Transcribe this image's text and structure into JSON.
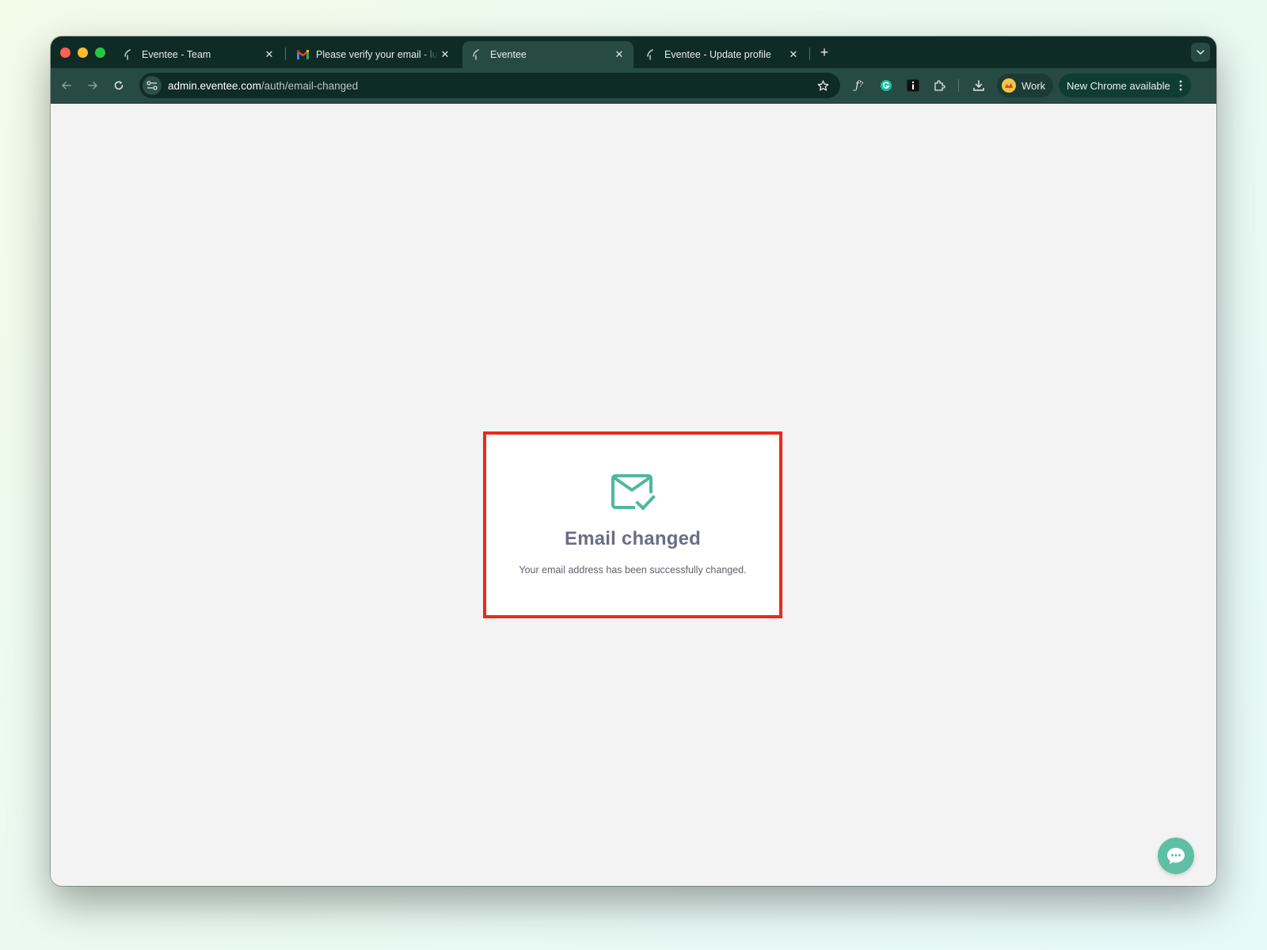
{
  "browser": {
    "tabs": [
      {
        "title": "Eventee - Team",
        "favicon": "eventee-logo-icon",
        "active": false
      },
      {
        "title": "Please verify your email - luc",
        "favicon": "gmail-icon",
        "active": false
      },
      {
        "title": "Eventee",
        "favicon": "eventee-logo-icon",
        "active": true
      },
      {
        "title": "Eventee - Update profile",
        "favicon": "eventee-logo-icon",
        "active": false
      }
    ],
    "close_glyph": "✕",
    "new_tab_glyph": "+",
    "address_bar": {
      "host": "admin.eventee.com",
      "path": "/auth/email-changed"
    },
    "profile_label": "Work",
    "update_label": "New Chrome available",
    "theme": {
      "frame": "#0f2b26",
      "toolbar": "#274a43"
    }
  },
  "page": {
    "card": {
      "icon": "mail-check-icon",
      "title": "Email changed",
      "message": "Your email address has been successfully changed.",
      "accent": "#4fb89b",
      "highlight_border": "#f0271a"
    },
    "chat_button_icon": "chat-bubble-icon"
  }
}
